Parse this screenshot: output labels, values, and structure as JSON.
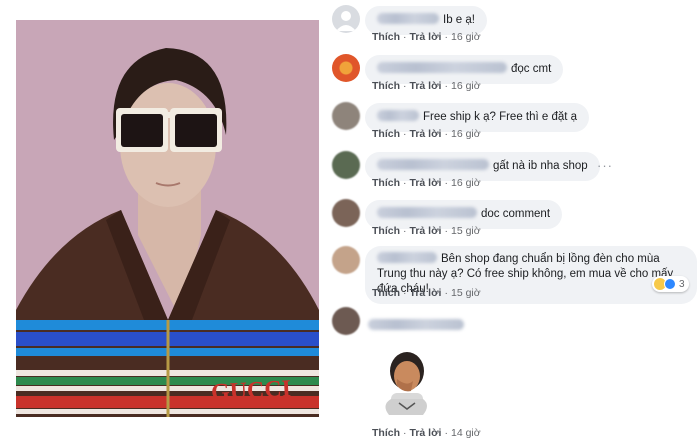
{
  "post": {
    "photo_brand_text": "GUCCI"
  },
  "actions": {
    "like": "Thích",
    "reply": "Trả lời",
    "sep": "·"
  },
  "comments": [
    {
      "text": "Ib e ạ!",
      "time": "16 giờ",
      "avatar": "#d9dce1"
    },
    {
      "text": "đọc cmt",
      "time": "16 giờ",
      "avatar": "#e0562a"
    },
    {
      "text": "Free ship k ạ? Free thì e đặt ạ",
      "time": "16 giờ",
      "avatar": "#8e847b"
    },
    {
      "text": "gất nà ib nha shop",
      "time": "16 giờ",
      "avatar": "#5a6a52"
    },
    {
      "text": "doc comment",
      "time": "15 giờ",
      "avatar": "#7b6458"
    },
    {
      "text": "Bên shop đang chuẩn bị lồng đèn cho mùa Trung thu này ạ? Có free ship không, em mua về cho mấy đứa cháu!",
      "time": "15 giờ",
      "avatar": "#c4a38a",
      "reaction_count": "3"
    },
    {
      "text": "",
      "time": "",
      "avatar": "#6d5a52"
    },
    {
      "sticker": "avatar-sticker",
      "time": "14 giờ",
      "avatar": "#5a5a5a"
    }
  ],
  "colors": {
    "bubble": "#f0f2f5",
    "meta": "#65676b",
    "like_blue": "#2d88ff"
  }
}
